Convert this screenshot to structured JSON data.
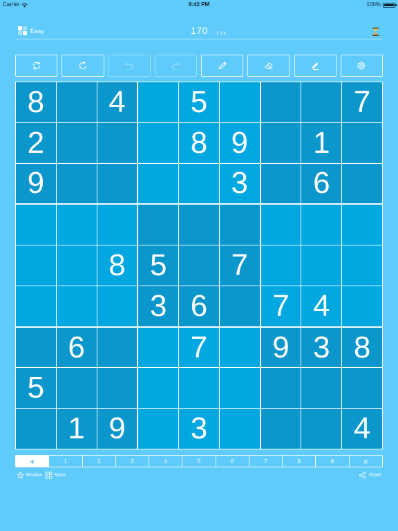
{
  "status_bar": {
    "carrier": "Carrier",
    "time": "9:42 PM",
    "battery": "100%",
    "battery_level": 1.0
  },
  "header": {
    "difficulty": "Easy",
    "score": "170",
    "mistakes": "xxx"
  },
  "toolbar": {
    "buttons": [
      {
        "name": "new-game",
        "icon": "shuffle-icon",
        "enabled": true
      },
      {
        "name": "restart",
        "icon": "refresh-icon",
        "enabled": true
      },
      {
        "name": "undo",
        "icon": "undo-icon",
        "enabled": false
      },
      {
        "name": "redo",
        "icon": "redo-icon",
        "enabled": false
      },
      {
        "name": "pencil",
        "icon": "pencil-icon",
        "enabled": true
      },
      {
        "name": "eraser",
        "icon": "eraser-icon",
        "enabled": true
      },
      {
        "name": "auto-notes",
        "icon": "marker-icon",
        "enabled": true
      },
      {
        "name": "settings",
        "icon": "gear-icon",
        "enabled": true
      }
    ]
  },
  "board": {
    "colors": {
      "dark": "#0b96cc",
      "light": "#00a7e0",
      "grid": "#ffffff"
    },
    "rows": [
      [
        "8",
        "",
        "4",
        "",
        "5",
        "",
        "",
        "",
        "7"
      ],
      [
        "2",
        "",
        "",
        "",
        "8",
        "9",
        "",
        "1",
        ""
      ],
      [
        "9",
        "",
        "",
        "",
        "",
        "3",
        "",
        "6",
        ""
      ],
      [
        "",
        "",
        "",
        "",
        "",
        "",
        "",
        "",
        ""
      ],
      [
        "",
        "",
        "8",
        "5",
        "",
        "7",
        "",
        "",
        ""
      ],
      [
        "",
        "",
        "",
        "3",
        "6",
        "",
        "7",
        "4",
        ""
      ],
      [
        "",
        "6",
        "",
        "",
        "7",
        "",
        "9",
        "3",
        "8"
      ],
      [
        "5",
        "",
        "",
        "",
        "",
        "",
        "",
        "",
        ""
      ],
      [
        "",
        "1",
        "9",
        "",
        "3",
        "",
        "",
        "",
        "4"
      ]
    ]
  },
  "number_bar": {
    "items": [
      "+",
      "1",
      "2",
      "3",
      "4",
      "5",
      "6",
      "7",
      "8",
      "9",
      "×"
    ],
    "selected": 0
  },
  "footer": {
    "review_label": "Review",
    "more_label": "More",
    "share_label": "Share"
  }
}
